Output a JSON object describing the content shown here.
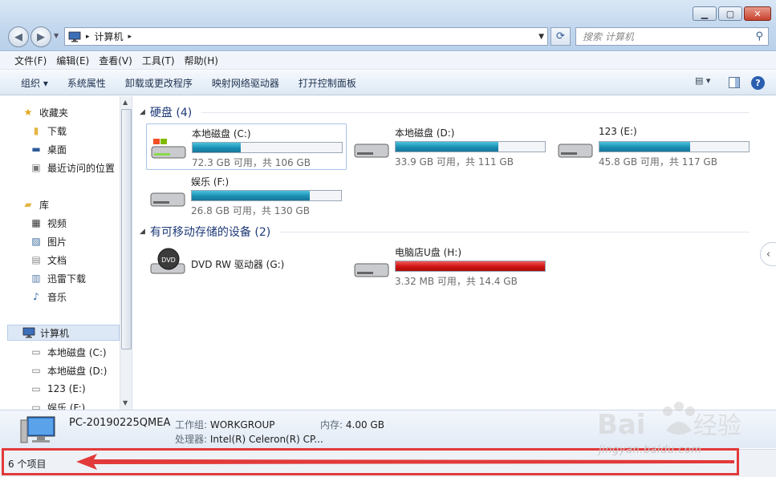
{
  "window": {
    "minimize_icon": "minimize-icon",
    "maximize_icon": "maximize-icon",
    "close_icon": "close-icon"
  },
  "address": {
    "root_icon": "computer-icon",
    "path": "计算机",
    "search_placeholder": "搜索 计算机"
  },
  "menubar": {
    "items": [
      "文件(F)",
      "编辑(E)",
      "查看(V)",
      "工具(T)",
      "帮助(H)"
    ]
  },
  "cmdbar": {
    "organize": "组织 ▾",
    "system_properties": "系统属性",
    "uninstall": "卸载或更改程序",
    "map_drive": "映射网络驱动器",
    "control_panel": "打开控制面板"
  },
  "sidebar": {
    "favorites": "收藏夹",
    "downloads": "下载",
    "desktop": "桌面",
    "recent": "最近访问的位置",
    "libraries": "库",
    "videos": "视频",
    "pictures": "图片",
    "documents": "文档",
    "xunlei": "迅雷下载",
    "music": "音乐",
    "computer": "计算机",
    "drive_c": "本地磁盘 (C:)",
    "drive_d": "本地磁盘 (D:)",
    "drive_e": "123 (E:)",
    "drive_f": "娱乐 (F:)"
  },
  "content": {
    "hdd_section": "硬盘 (4)",
    "removable_section": "有可移动存储的设备 (2)",
    "drives": [
      {
        "name": "本地磁盘 (C:)",
        "info": "72.3 GB 可用，共 106 GB",
        "used_fraction": 0.32
      },
      {
        "name": "本地磁盘 (D:)",
        "info": "33.9 GB 可用，共 111 GB",
        "used_fraction": 0.69
      },
      {
        "name": "123 (E:)",
        "info": "45.8 GB 可用，共 117 GB",
        "used_fraction": 0.61
      },
      {
        "name": "娱乐 (F:)",
        "info": "26.8 GB 可用，共 130 GB",
        "used_fraction": 0.79
      }
    ],
    "dvd": {
      "name": "DVD RW 驱动器 (G:)",
      "label": "DVD"
    },
    "usb": {
      "name": "电脑店U盘 (H:)",
      "info": "3.32 MB 可用，共 14.4 GB",
      "used_fraction": 0.999
    }
  },
  "details": {
    "pc_name": "PC-20190225QMEA",
    "workgroup_label": "工作组:",
    "workgroup": "WORKGROUP",
    "memory_label": "内存:",
    "memory": "4.00 GB",
    "cpu_label": "处理器:",
    "cpu": "Intel(R) Celeron(R) CP..."
  },
  "status": {
    "items_count": "6 个项目"
  },
  "watermark": {
    "site": "jingyan.baidu.com"
  },
  "colors": {
    "bar_fill": "#1b8fb4",
    "bar_fill_full": "#cf1212",
    "annotation": "#e23a3a",
    "section_text": "#1e3a78"
  }
}
